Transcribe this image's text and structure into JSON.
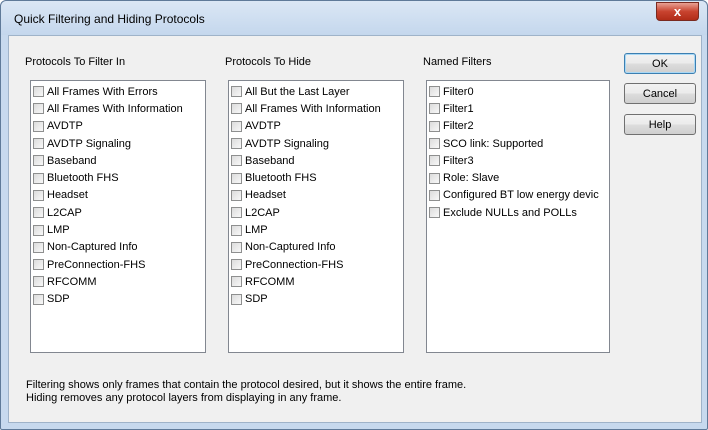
{
  "window": {
    "title": "Quick Filtering and Hiding Protocols",
    "close_glyph": "x"
  },
  "filter_in": {
    "label": "Protocols To Filter In",
    "items": [
      "All Frames With Errors",
      "All Frames With Information",
      "AVDTP",
      "AVDTP Signaling",
      "Baseband",
      "Bluetooth FHS",
      "Headset",
      "L2CAP",
      "LMP",
      "Non-Captured Info",
      "PreConnection-FHS",
      "RFCOMM",
      "SDP"
    ]
  },
  "hide": {
    "label": "Protocols To Hide",
    "items": [
      "All But the Last Layer",
      "All Frames With Information",
      "AVDTP",
      "AVDTP Signaling",
      "Baseband",
      "Bluetooth FHS",
      "Headset",
      "L2CAP",
      "LMP",
      "Non-Captured Info",
      "PreConnection-FHS",
      "RFCOMM",
      "SDP"
    ]
  },
  "named": {
    "label": "Named Filters",
    "items": [
      "Filter0",
      "Filter1",
      "Filter2",
      "SCO link: Supported",
      "Filter3",
      "Role: Slave",
      "Configured BT low energy devic",
      "Exclude NULLs and POLLs"
    ]
  },
  "buttons": {
    "ok": "OK",
    "cancel": "Cancel",
    "help": "Help"
  },
  "info": {
    "line1": "Filtering shows only frames that contain the protocol desired, but it shows the entire frame.",
    "line2": "Hiding removes any protocol layers from displaying in any frame."
  }
}
